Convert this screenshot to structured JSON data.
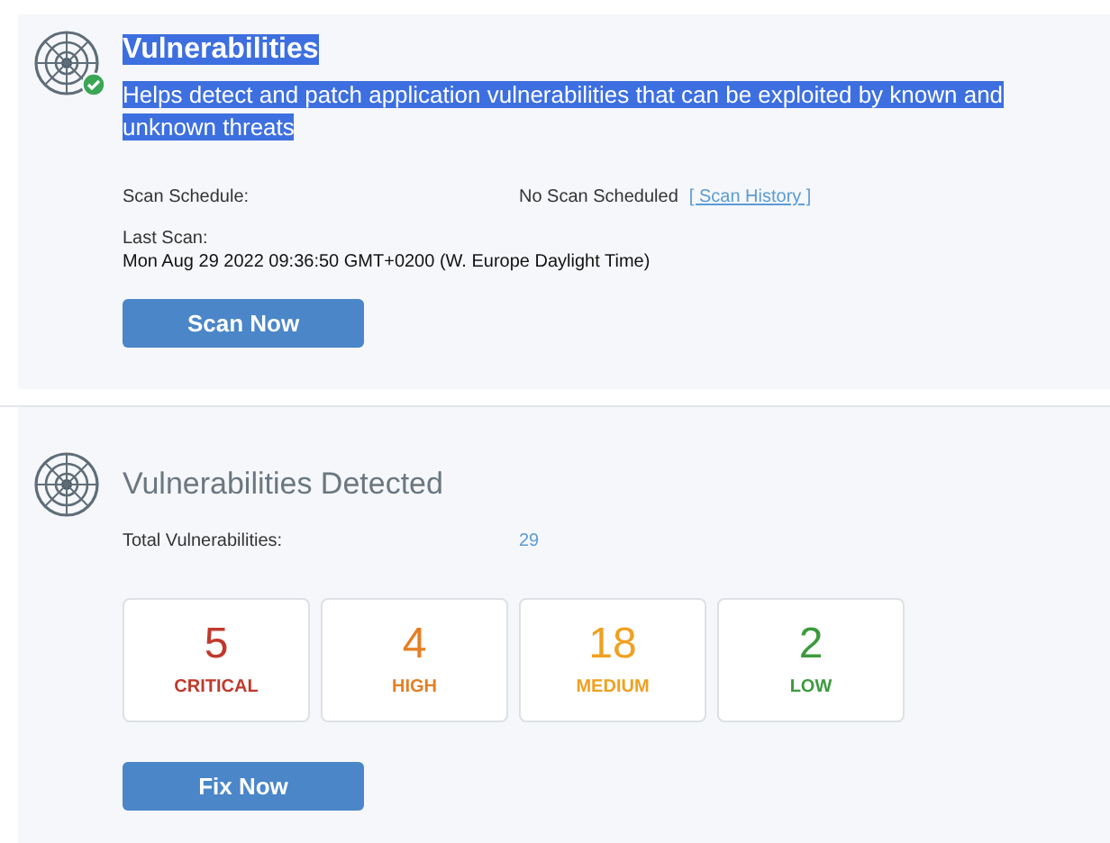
{
  "scan_panel": {
    "title": {
      "text": "Vulnerabilities",
      "highlighted": true
    },
    "description": {
      "text": "Helps detect and patch application vulnerabilities that can be exploited by known and unknown threats",
      "highlighted": true
    },
    "status_ok": true,
    "schedule_label": "Scan Schedule:",
    "schedule_value": "No Scan Scheduled",
    "history_link": "[ Scan History ]",
    "last_scan_label": "Last Scan:",
    "last_scan_value": "Mon Aug 29 2022 09:36:50 GMT+0200 (W. Europe Daylight Time)",
    "button": "Scan Now"
  },
  "detected_panel": {
    "title": "Vulnerabilities Detected",
    "total_label": "Total Vulnerabilities:",
    "total_value": "29",
    "severities": [
      {
        "count": "5",
        "label": "CRITICAL",
        "color": "#c0392b"
      },
      {
        "count": "4",
        "label": "HIGH",
        "color": "#e67e22"
      },
      {
        "count": "18",
        "label": "MEDIUM",
        "color": "#f0a020"
      },
      {
        "count": "2",
        "label": "LOW",
        "color": "#3d9a3d"
      }
    ],
    "button": "Fix Now"
  }
}
